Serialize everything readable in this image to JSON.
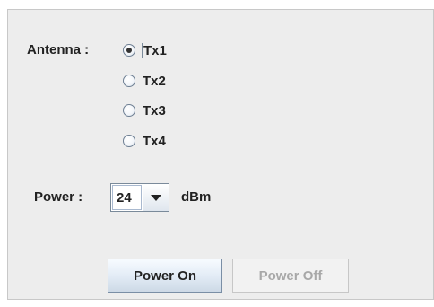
{
  "antenna": {
    "label": "Antenna :",
    "options": [
      {
        "label": "Tx1",
        "checked": true
      },
      {
        "label": "Tx2",
        "checked": false
      },
      {
        "label": "Tx3",
        "checked": false
      },
      {
        "label": "Tx4",
        "checked": false
      }
    ]
  },
  "power": {
    "label": "Power :",
    "value": "24",
    "unit": "dBm"
  },
  "buttons": {
    "on_label": "Power On",
    "off_label": "Power Off",
    "off_enabled": false
  },
  "icons": {
    "dropdown": "chevron-down-icon"
  }
}
